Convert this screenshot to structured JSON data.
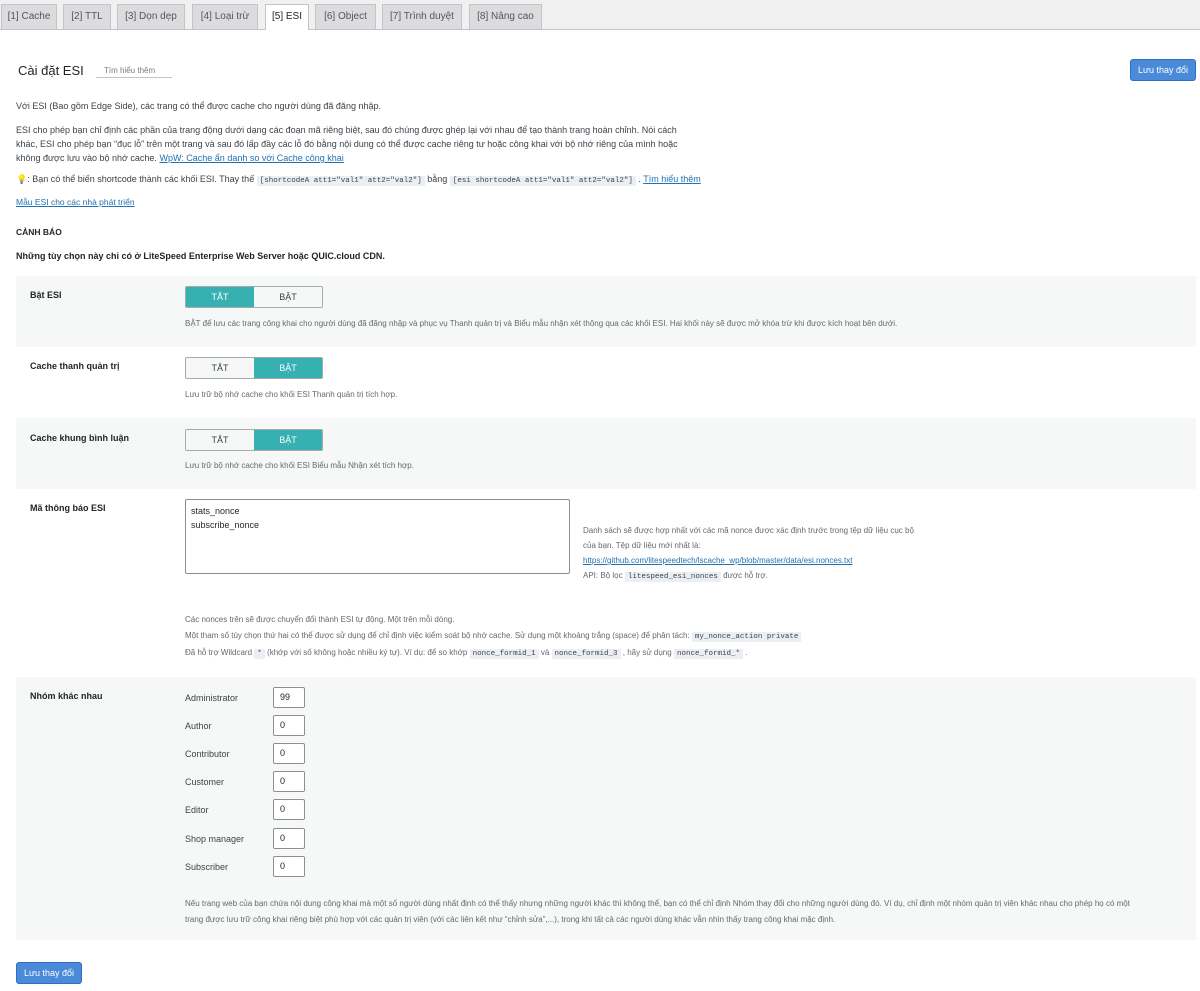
{
  "tabs": [
    "[1] Cache",
    "[2] TTL",
    "[3] Dọn dẹp",
    "[4] Loại trừ",
    "[5] ESI",
    "[6] Object",
    "[7] Trình duyệt",
    "[8] Nâng cao"
  ],
  "header": {
    "title": "Cài đặt ESI",
    "learn_more": "Tìm hiểu thêm",
    "save": "Lưu thay đổi"
  },
  "intro": {
    "p1": "Với ESI (Bao gồm Edge Side), các trang có thể được cache cho người dùng đã đăng nhập.",
    "p2_line1": "ESI cho phép bạn chỉ định các phần của trang động dưới dạng các đoạn mã riêng biệt, sau đó chúng được ghép lại với nhau để tạo thành trang hoàn chỉnh. Nói cách",
    "p2_line2": "khác, ESI cho phép bạn “đục lỗ” trên một trang và sau đó lấp đầy các lỗ đó bằng nội dung có thể được cache riêng tư hoặc công khai với bộ nhớ riêng của mình hoặc",
    "p2_line3": "không được lưu vào bộ nhớ cache.",
    "p2_link": "WpW: Cache ẩn danh so với Cache công khai",
    "tip_icon": "lightbulb-icon",
    "tip_text1": ": Bạn có thể biến shortcode thành các khối ESI. Thay thế",
    "tip_code1": "[shortcodeA att1=\"val1\" att2=\"val2\"]",
    "tip_text2": "bằng",
    "tip_code2": "[esi shortcodeA att1=\"val1\" att2=\"val2\"]",
    "tip_text3": ".",
    "tip_link": "Tìm hiểu thêm",
    "dev_link": "Mẫu ESI cho các nhà phát triển"
  },
  "warning": {
    "heading": "CẢNH BÁO",
    "text": "Những tùy chọn này chỉ có ở LiteSpeed Enterprise Web Server hoặc QUIC.cloud CDN."
  },
  "settings": {
    "enable_esi": {
      "label": "Bật ESI",
      "off": "TẮT",
      "on": "BẬT",
      "value": "off",
      "desc": "BẬT để lưu các trang công khai cho người dùng đã đăng nhập và phục vụ Thanh quản trị và Biểu mẫu nhận xét thông qua các khối ESI. Hai khối này sẽ được mở khóa trừ khi được kích hoạt bên dưới."
    },
    "cache_admin_bar": {
      "label": "Cache thanh quản trị",
      "off": "TẮT",
      "on": "BẬT",
      "value": "on",
      "desc": "Lưu trữ bộ nhớ cache cho khối ESI Thanh quản trị tích hợp."
    },
    "cache_comment_form": {
      "label": "Cache khung bình luận",
      "off": "TẮT",
      "on": "BẬT",
      "value": "on",
      "desc": "Lưu trữ bộ nhớ cache cho khối ESI Biểu mẫu Nhận xét tích hợp."
    },
    "esi_nonces": {
      "label": "Mã thông báo ESI",
      "lines": [
        "stats_nonce",
        "subscribe_nonce"
      ],
      "side1": "Danh sách sẽ được hợp nhất với các mã nonce được xác định trước trong tệp dữ liệu cục bộ",
      "side2": "của bạn. Tệp dữ liệu mới nhất là:",
      "side_link": "https://github.com/litespeedtech/lscache_wp/blob/master/data/esi.nonces.txt",
      "side_api_pre": "API: Bộ lọc",
      "side_api_code": "litespeed_esi_nonces",
      "side_api_post": "được hỗ trợ.",
      "b1": "Các nonces trên sẽ được chuyển đổi thành ESI tự động. Một trên mỗi dòng.",
      "b2_pre": "Một tham số tùy chọn thứ hai có thể được sử dụng để chỉ định việc kiểm soát bộ nhớ cache. Sử dụng một khoảng trắng (space) để phân tách:",
      "b2_code": "my_nonce_action private",
      "b3_pre": "Đã hỗ trợ Wildcard",
      "b3_code1": "*",
      "b3_mid1": "(khớp với số không hoặc nhiều ký tự). Ví dụ: để so khớp",
      "b3_code2": "nonce_formid_1",
      "b3_mid2": "và",
      "b3_code3": "nonce_formid_3",
      "b3_mid3": ", hãy sử dụng",
      "b3_code4": "nonce_formid_*",
      "b3_end": "."
    },
    "vary_group": {
      "label": "Nhóm khác nhau",
      "roles": [
        {
          "name": "Administrator",
          "value": "99"
        },
        {
          "name": "Author",
          "value": "0"
        },
        {
          "name": "Contributor",
          "value": "0"
        },
        {
          "name": "Customer",
          "value": "0"
        },
        {
          "name": "Editor",
          "value": "0"
        },
        {
          "name": "Shop manager",
          "value": "0"
        },
        {
          "name": "Subscriber",
          "value": "0"
        }
      ],
      "desc1": "Nếu trang web của bạn chứa nội dung công khai mà một số người dùng nhất định có thể thấy nhưng những người khác thì không thể, bạn có thể chỉ định Nhóm thay đổi cho những người dùng đó. Ví dụ, chỉ định một nhóm quản trị viên khác nhau cho phép họ có một",
      "desc2": "trang được lưu trữ công khai riêng biệt phù hợp với các quản trị viên (với các liên kết như “chỉnh sửa”,...), trong khi tất cả các người dùng khác vẫn nhìn thấy trang công khai mặc định."
    }
  },
  "footer": {
    "save": "Lưu thay đổi"
  }
}
